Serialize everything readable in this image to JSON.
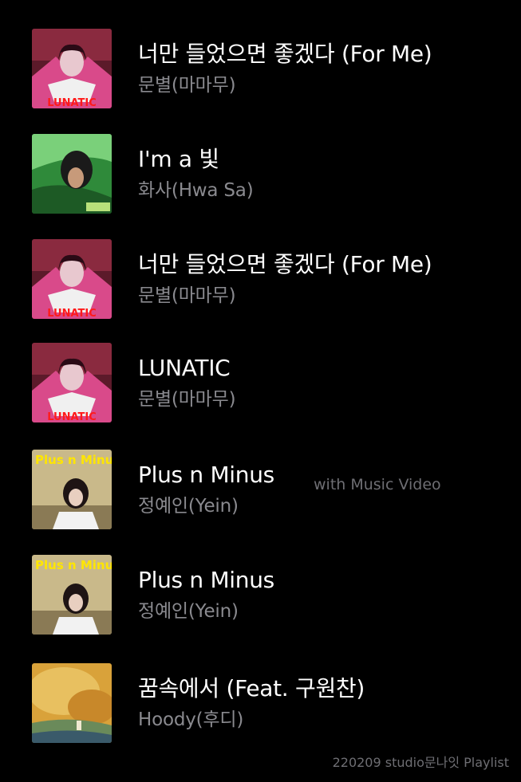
{
  "tracks": [
    {
      "title": "너만 들었으면 좋겠다 (For Me)",
      "artist": "문별(마마무)",
      "art_text": "LUNATIC",
      "art_icon": "album-art-lunatic-icon",
      "badge": ""
    },
    {
      "title": "I'm a 빛",
      "artist": "화사(Hwa Sa)",
      "art_text": "",
      "art_icon": "album-art-hwasa-icon",
      "badge": ""
    },
    {
      "title": "너만 들었으면 좋겠다 (For Me)",
      "artist": "문별(마마무)",
      "art_text": "LUNATIC",
      "art_icon": "album-art-lunatic-icon",
      "badge": ""
    },
    {
      "title": "LUNATIC",
      "artist": "문별(마마무)",
      "art_text": "LUNATIC",
      "art_icon": "album-art-lunatic-icon",
      "badge": ""
    },
    {
      "title": "Plus n Minus",
      "artist": "정예인(Yein)",
      "art_text": "Plus n Minus",
      "art_icon": "album-art-plus-n-minus-icon",
      "badge": "with Music Video"
    },
    {
      "title": "Plus n Minus",
      "artist": "정예인(Yein)",
      "art_text": "Plus n Minus",
      "art_icon": "album-art-plus-n-minus-icon",
      "badge": ""
    },
    {
      "title": "꿈속에서 (Feat. 구원찬)",
      "artist": "Hoody(후디)",
      "art_text": "",
      "art_icon": "album-art-hoody-icon",
      "badge": ""
    }
  ],
  "footer": "220209 studio문나잇 Playlist",
  "colors": {
    "background": "#000000",
    "title": "#ffffff",
    "subtitle": "#8a8a8f",
    "badge": "#6e6e73"
  }
}
